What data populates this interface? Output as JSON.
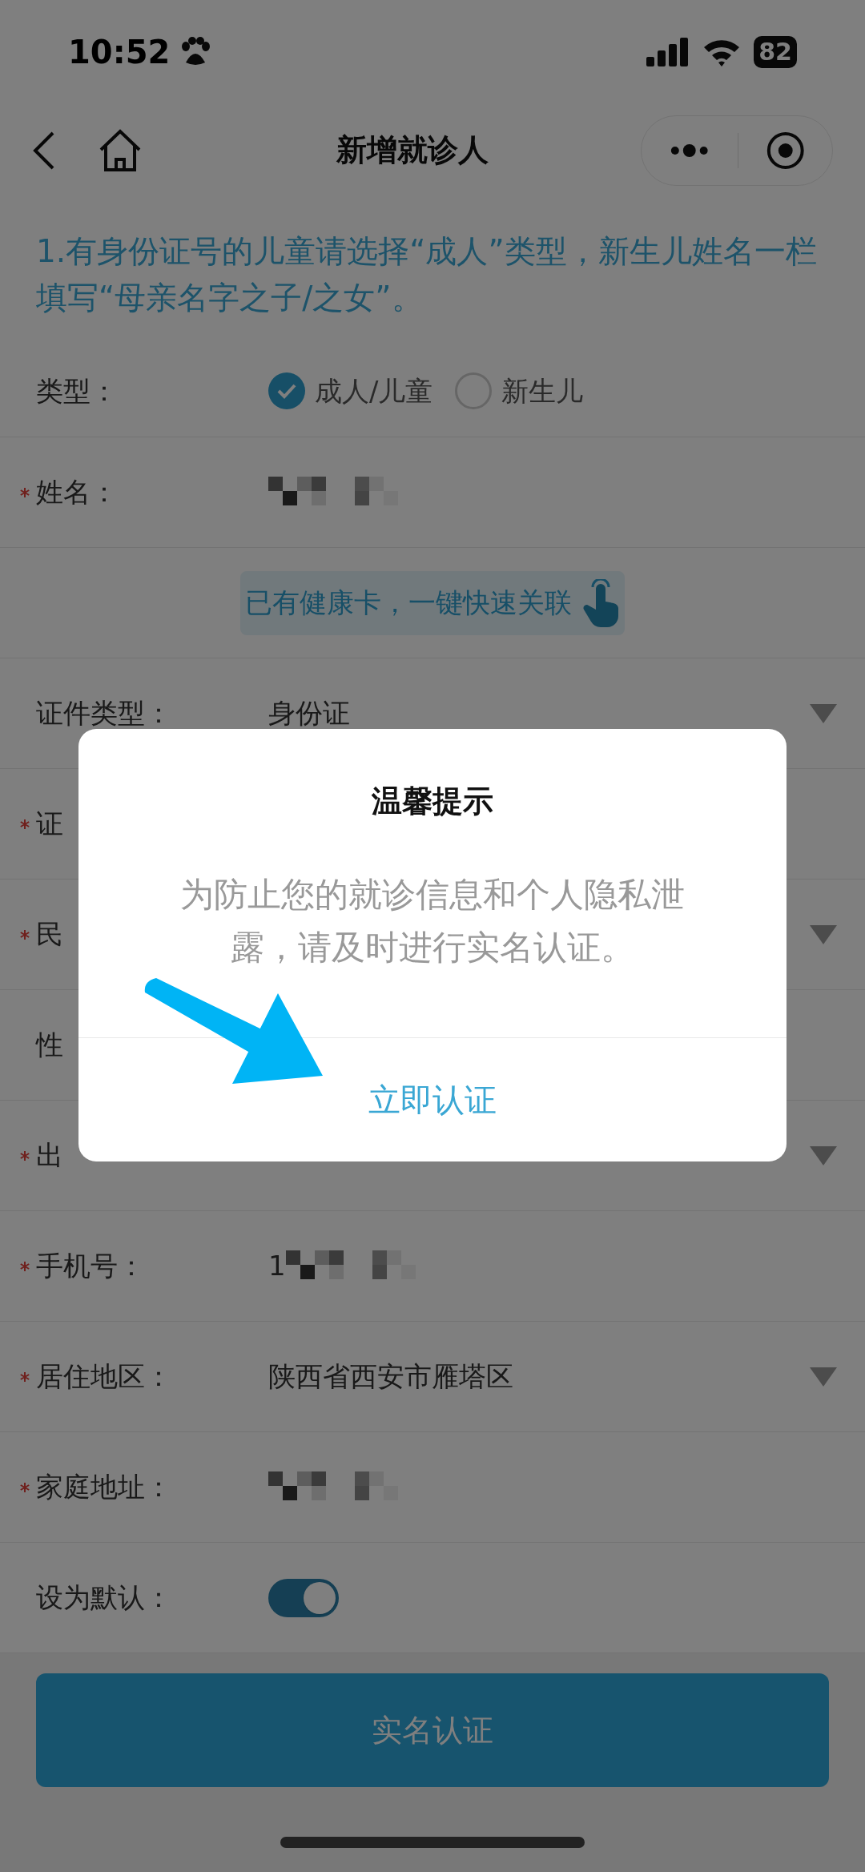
{
  "status_bar": {
    "time": "10:52",
    "battery": "82"
  },
  "nav": {
    "title": "新增就诊人"
  },
  "hint": {
    "text": "1.有身份证号的儿童请选择“成人”类型，新生儿姓名一栏填写“母亲名字之子/之女”。"
  },
  "rows": [
    {
      "kind": "radio",
      "label": "类型：",
      "required": false,
      "options": [
        {
          "label": "成人/儿童",
          "selected": true
        },
        {
          "label": "新生儿",
          "selected": false
        }
      ]
    },
    {
      "kind": "text",
      "label": "姓名：",
      "required": true,
      "redacted": true
    },
    {
      "kind": "link",
      "label": "已有健康卡，一键快速关联"
    },
    {
      "kind": "text",
      "label": "证件类型：",
      "required": false,
      "value": "身份证",
      "dropdown": true
    },
    {
      "kind": "text",
      "label": "证",
      "required": true
    },
    {
      "kind": "text",
      "label": "民",
      "required": true,
      "dropdown": true
    },
    {
      "kind": "text",
      "label": "性",
      "required": false
    },
    {
      "kind": "text",
      "label": "出",
      "required": true,
      "dropdown": true
    },
    {
      "kind": "text",
      "label": "手机号：",
      "required": true,
      "value": "1",
      "redacted": true
    },
    {
      "kind": "text",
      "label": "居住地区：",
      "required": true,
      "value": "陕西省西安市雁塔区",
      "dropdown": true
    },
    {
      "kind": "text",
      "label": "家庭地址：",
      "required": true,
      "redacted": true
    },
    {
      "kind": "switch",
      "label": "设为默认：",
      "required": false,
      "on": true
    }
  ],
  "submit": {
    "label": "实名认证"
  },
  "dialog": {
    "title": "温馨提示",
    "message": "为防止您的就诊信息和个人隐私泄露，请及时进行实名认证。",
    "action": "立即认证"
  }
}
